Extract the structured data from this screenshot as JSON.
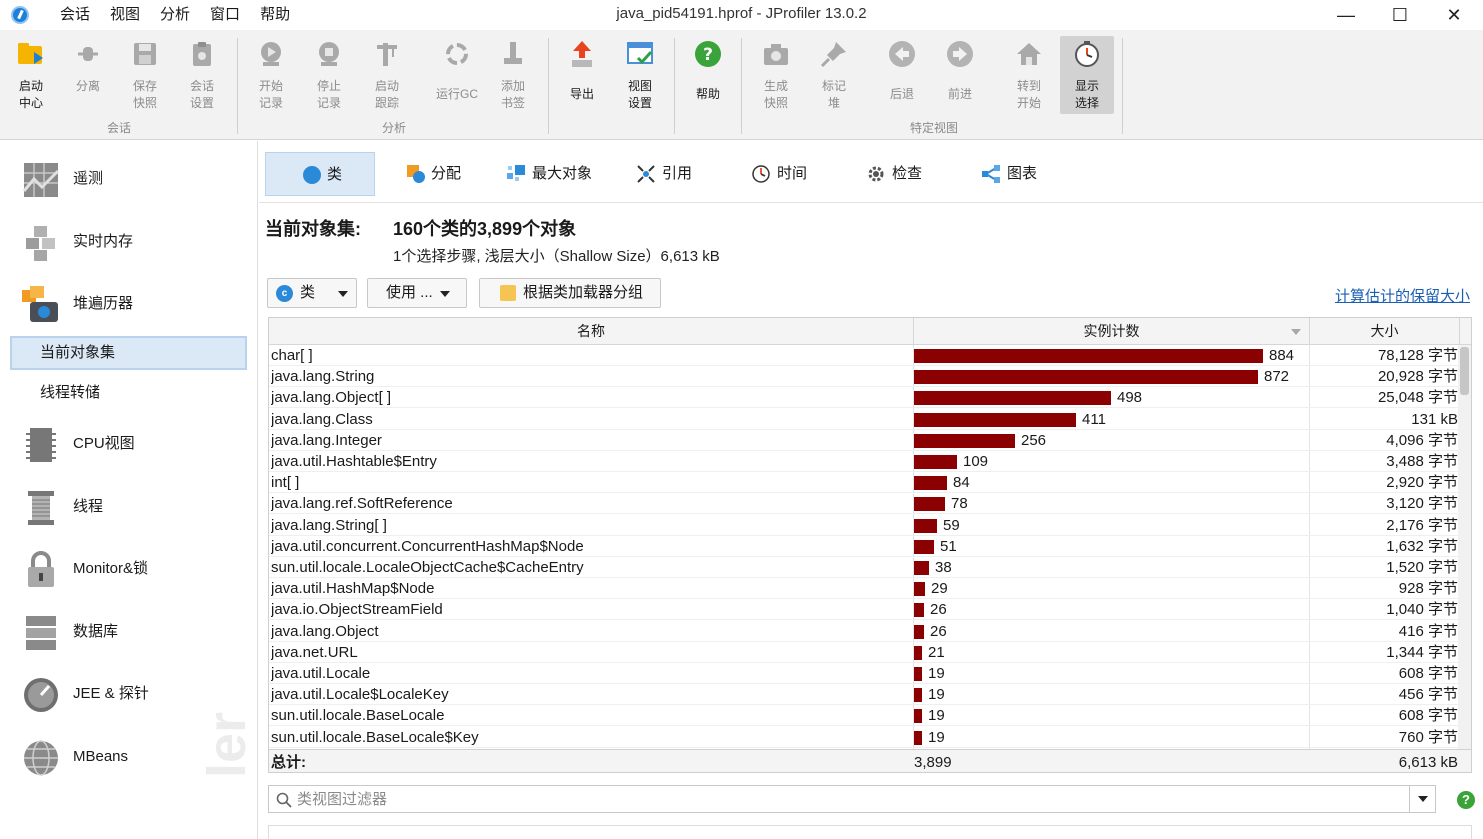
{
  "window": {
    "title": "java_pid54191.hprof - JProfiler 13.0.2"
  },
  "menu": [
    "会话",
    "视图",
    "分析",
    "窗口",
    "帮助"
  ],
  "toolbar": {
    "groups": [
      {
        "label": "会话",
        "buttons": [
          "启动\n中心",
          "分离",
          "保存\n快照",
          "会话\n设置"
        ]
      },
      {
        "label": "分析",
        "buttons": [
          "开始\n记录",
          "停止\n记录",
          "启动\n跟踪",
          "运行GC",
          "添加\n书签"
        ]
      },
      {
        "label": "",
        "buttons": [
          "导出",
          "视图\n设置"
        ]
      },
      {
        "label": "",
        "buttons": [
          "帮助"
        ]
      },
      {
        "label": "特定视图",
        "buttons": [
          "生成\n快照",
          "标记\n堆",
          "后退",
          "前进",
          "转到\n开始",
          "显示\n选择"
        ]
      }
    ]
  },
  "sidebar": {
    "items": [
      "遥测",
      "实时内存",
      "堆遍历器",
      "CPU视图",
      "线程",
      "Monitor&锁",
      "数据库",
      "JEE & 探针",
      "MBeans"
    ],
    "subitems": [
      "当前对象集",
      "线程转储"
    ]
  },
  "tabs": [
    "类",
    "分配",
    "最大对象",
    "引用",
    "时间",
    "检查",
    "图表"
  ],
  "summary": {
    "label": "当前对象集:",
    "value": "160个类的3,899个对象",
    "detail": "1个选择步骤, 浅层大小（Shallow Size）6,613 kB"
  },
  "controls": {
    "view_select": "类",
    "usage_select": "使用 ...",
    "group_button": "根据类加载器分组",
    "retained_link": "计算估计的保留大小"
  },
  "table": {
    "columns": [
      "名称",
      "实例计数",
      "大小"
    ],
    "max_count": 884,
    "rows": [
      {
        "name": "char[ ]",
        "count": 884,
        "count_label": "884",
        "size": "78,128 字节"
      },
      {
        "name": "java.lang.String",
        "count": 872,
        "count_label": "872",
        "size": "20,928 字节"
      },
      {
        "name": "java.lang.Object[ ]",
        "count": 498,
        "count_label": "498",
        "size": "25,048 字节"
      },
      {
        "name": "java.lang.Class",
        "count": 411,
        "count_label": "411",
        "size": "131 kB"
      },
      {
        "name": "java.lang.Integer",
        "count": 256,
        "count_label": "256",
        "size": "4,096 字节"
      },
      {
        "name": "java.util.Hashtable$Entry",
        "count": 109,
        "count_label": "109",
        "size": "3,488 字节"
      },
      {
        "name": "int[ ]",
        "count": 84,
        "count_label": "84",
        "size": "2,920 字节"
      },
      {
        "name": "java.lang.ref.SoftReference",
        "count": 78,
        "count_label": "78",
        "size": "3,120 字节"
      },
      {
        "name": "java.lang.String[ ]",
        "count": 59,
        "count_label": "59",
        "size": "2,176 字节"
      },
      {
        "name": "java.util.concurrent.ConcurrentHashMap$Node",
        "count": 51,
        "count_label": "51",
        "size": "1,632 字节"
      },
      {
        "name": "sun.util.locale.LocaleObjectCache$CacheEntry",
        "count": 38,
        "count_label": "38",
        "size": "1,520 字节"
      },
      {
        "name": "java.util.HashMap$Node",
        "count": 29,
        "count_label": "29",
        "size": "928 字节"
      },
      {
        "name": "java.io.ObjectStreamField",
        "count": 26,
        "count_label": "26",
        "size": "1,040 字节"
      },
      {
        "name": "java.lang.Object",
        "count": 26,
        "count_label": "26",
        "size": "416 字节"
      },
      {
        "name": "java.net.URL",
        "count": 21,
        "count_label": "21",
        "size": "1,344 字节"
      },
      {
        "name": "java.util.Locale",
        "count": 19,
        "count_label": "19",
        "size": "608 字节"
      },
      {
        "name": "java.util.Locale$LocaleKey",
        "count": 19,
        "count_label": "19",
        "size": "456 字节"
      },
      {
        "name": "sun.util.locale.BaseLocale",
        "count": 19,
        "count_label": "19",
        "size": "608 字节"
      },
      {
        "name": "sun.util.locale.BaseLocale$Key",
        "count": 19,
        "count_label": "19",
        "size": "760 字节"
      }
    ],
    "total": {
      "label": "总计:",
      "count": "3,899",
      "size": "6,613 kB"
    }
  },
  "filter": {
    "placeholder": "类视图过滤器"
  },
  "colors": {
    "bar": "#8b0000",
    "selection": "#dbe8f6",
    "link": "#1a5fb4"
  }
}
